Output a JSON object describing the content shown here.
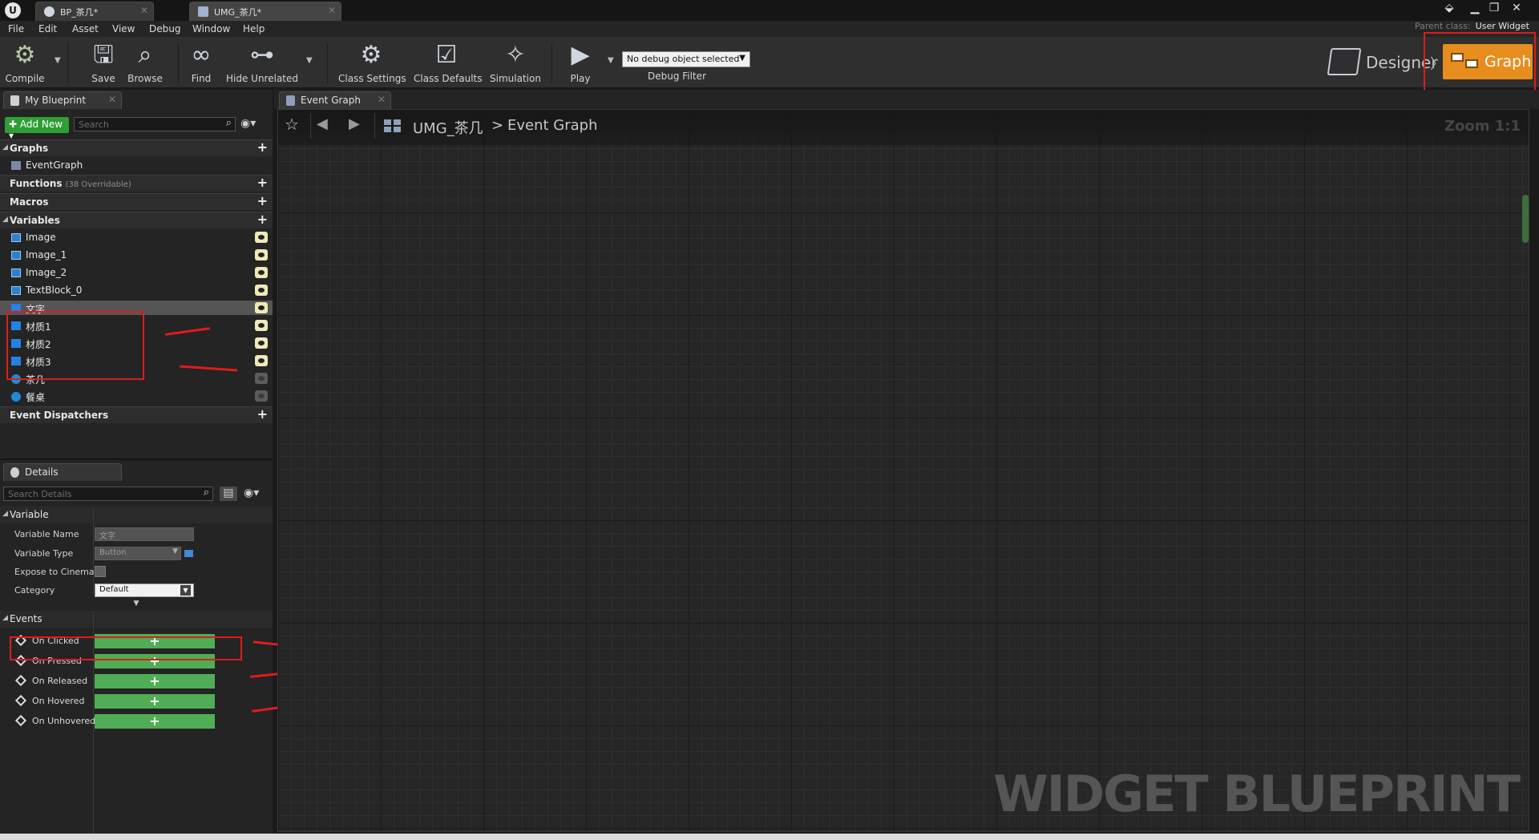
{
  "tabs": [
    {
      "label": "BP_茶几*"
    },
    {
      "label": "UMG_茶几*"
    }
  ],
  "parent_class": {
    "label": "Parent class:",
    "value": "User Widget"
  },
  "menu": [
    "File",
    "Edit",
    "Asset",
    "View",
    "Debug",
    "Window",
    "Help"
  ],
  "toolbar": {
    "compile": "Compile",
    "save": "Save",
    "browse": "Browse",
    "find": "Find",
    "hide_unrelated": "Hide Unrelated",
    "class_settings": "Class Settings",
    "class_defaults": "Class Defaults",
    "simulation": "Simulation",
    "play": "Play",
    "debug_object": "No debug object selected",
    "debug_filter": "Debug Filter",
    "designer": "Designer",
    "graph": "Graph"
  },
  "my_blueprint": {
    "tab": "My Blueprint",
    "add_new": "Add New",
    "search_placeholder": "Search",
    "sections": {
      "graphs": "Graphs",
      "functions": "Functions",
      "functions_sub": "(38 Overridable)",
      "macros": "Macros",
      "variables": "Variables",
      "dispatchers": "Event Dispatchers"
    },
    "graphs": [
      "EventGraph"
    ],
    "variables": [
      "Image",
      "Image_1",
      "Image_2",
      "TextBlock_0",
      "文字",
      "材质1",
      "材质2",
      "材质3",
      "茶几",
      "餐桌"
    ]
  },
  "details": {
    "tab": "Details",
    "search_placeholder": "Search Details",
    "variable_section": "Variable",
    "fields": {
      "name_label": "Variable Name",
      "name_value": "文字",
      "type_label": "Variable Type",
      "type_value": "Button",
      "expose_label": "Expose to Cinemat",
      "category_label": "Category",
      "category_value": "Default"
    },
    "events_section": "Events",
    "events": [
      "On Clicked",
      "On Pressed",
      "On Released",
      "On Hovered",
      "On Unhovered"
    ]
  },
  "graph": {
    "tab": "Event Graph",
    "crumb_root": "UMG_茶几",
    "crumb_sep": ">",
    "crumb_leaf": "Event Graph",
    "zoom": "Zoom 1:1",
    "watermark": "WIDGET BLUEPRINT"
  },
  "colors": {
    "accent_graph": "#e78d1e",
    "annotation_red": "#e01b1b",
    "add_green": "#2f9e34"
  }
}
